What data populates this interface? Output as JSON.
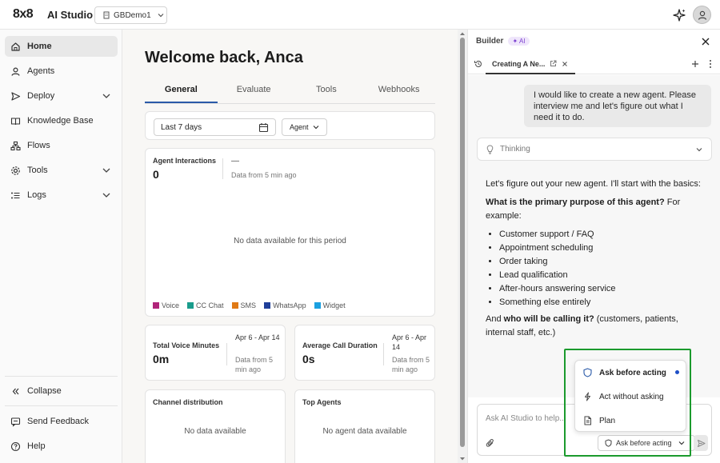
{
  "topbar": {
    "logo": "8x8",
    "app_name": "AI Studio",
    "workspace": "GBDemo1"
  },
  "sidebar": {
    "items": [
      {
        "label": "Home",
        "icon": "home-icon"
      },
      {
        "label": "Agents",
        "icon": "user-icon"
      },
      {
        "label": "Deploy",
        "icon": "send-icon"
      },
      {
        "label": "Knowledge Base",
        "icon": "book-icon"
      },
      {
        "label": "Flows",
        "icon": "flows-icon"
      },
      {
        "label": "Tools",
        "icon": "gear-icon"
      },
      {
        "label": "Logs",
        "icon": "list-icon"
      }
    ],
    "collapse": "Collapse",
    "feedback": "Send Feedback",
    "help": "Help"
  },
  "main": {
    "welcome": "Welcome back, Anca",
    "tabs": [
      "General",
      "Evaluate",
      "Tools",
      "Webhooks"
    ],
    "date_range": "Last 7 days",
    "agent_filter": "Agent",
    "interactions": {
      "label": "Agent Interactions",
      "value": "0",
      "dash": "—",
      "freshness": "Data from 5 min ago",
      "empty": "No data available for this period",
      "legend": [
        {
          "name": "Voice",
          "color": "#b0247a"
        },
        {
          "name": "CC Chat",
          "color": "#1a9c8c"
        },
        {
          "name": "SMS",
          "color": "#e07a16"
        },
        {
          "name": "WhatsApp",
          "color": "#1f3f99"
        },
        {
          "name": "Widget",
          "color": "#1ba0e0"
        }
      ]
    },
    "voice_minutes": {
      "label": "Total Voice Minutes",
      "value": "0m",
      "range": "Apr 6 - Apr 14",
      "freshness": "Data from 5 min ago"
    },
    "avg_duration": {
      "label": "Average Call Duration",
      "value": "0s",
      "range": "Apr 6 - Apr 14",
      "freshness": "Data from 5 min ago"
    },
    "channel": {
      "label": "Channel distribution",
      "empty": "No data available"
    },
    "top_agents": {
      "label": "Top Agents",
      "empty": "No agent data available"
    }
  },
  "builder": {
    "title": "Builder",
    "badge": "AI",
    "tab_title": "Creating A Ne...",
    "user_message": "I would like to create a new agent. Please interview me and let's figure out what I need it to do.",
    "thinking": "Thinking",
    "reply_intro": "Let's figure out your new agent. I'll start with the basics:",
    "question1_bold": "What is the primary purpose of this agent?",
    "question1_rest": " For example:",
    "options": [
      "Customer support / FAQ",
      "Appointment scheduling",
      "Order taking",
      "Lead qualification",
      "After-hours answering service",
      "Something else entirely"
    ],
    "question2_pre": "And ",
    "question2_bold": "who will be calling it?",
    "question2_rest": " (customers, patients, internal staff, etc.)",
    "composer_placeholder": "Ask AI Studio to help...",
    "mode_selected": "Ask before acting",
    "mode_options": [
      "Ask before acting",
      "Act without asking",
      "Plan"
    ]
  }
}
